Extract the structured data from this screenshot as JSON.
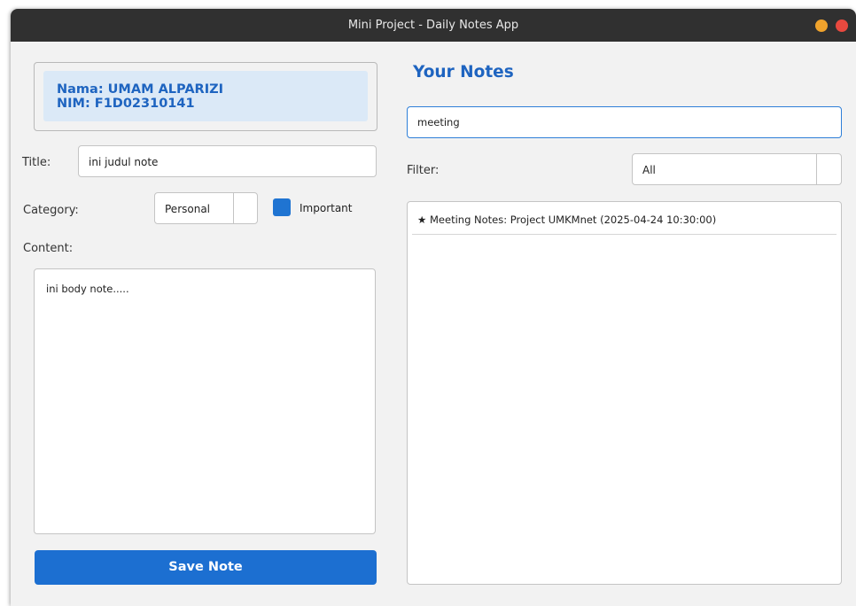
{
  "window": {
    "title": "Mini Project - Daily Notes App"
  },
  "identity": {
    "name": "Nama: UMAM ALPARIZI",
    "nim": "NIM: F1D02310141"
  },
  "form": {
    "title_label": "Title:",
    "title_value": "ini judul note",
    "category_label": "Category:",
    "category_value": "Personal",
    "important_label": "Important",
    "important_checked": true,
    "content_label": "Content:",
    "content_value": "ini body note.....",
    "save_label": "Save Note"
  },
  "notes": {
    "heading": "Your Notes",
    "search_value": "meeting",
    "filter_label": "Filter:",
    "filter_value": "All",
    "items": [
      {
        "star": "★",
        "text": "Meeting Notes: Project UMKMnet (2025-04-24 10:30:00)"
      }
    ]
  },
  "colors": {
    "accent": "#1c6fd1",
    "titlebar": "#303030",
    "minimize": "#f0a32c",
    "close": "#e9493f"
  }
}
